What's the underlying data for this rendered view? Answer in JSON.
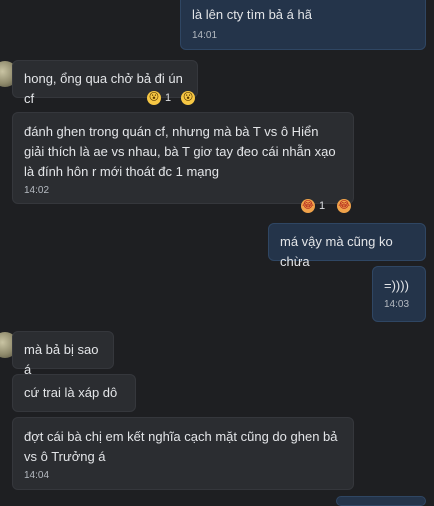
{
  "messages": [
    {
      "text": "là lên cty tìm bả á hã",
      "time": "14:01"
    },
    {
      "text": "hong, ổng qua chở bả đi ún cf",
      "reaction": {
        "emoji": "😮",
        "count": "1",
        "add_emoji": "😮"
      }
    },
    {
      "text": "đánh ghen trong quán cf, nhưng mà bà T vs ô Hiển giải thích là ae vs nhau, bà T giơ tay đeo cái nhẫn xạo là đính hôn r mới thoát đc 1 mạng",
      "time": "14:02",
      "reaction": {
        "emoji": "😂",
        "count": "1",
        "add_emoji": "😂"
      }
    },
    {
      "text": "má vậy mà cũng ko chừa"
    },
    {
      "text": "=))))",
      "time": "14:03"
    },
    {
      "text": "mà bả bị sao á"
    },
    {
      "text": "cứ trai là xáp dô"
    },
    {
      "text": "đợt cái bà chị em kết nghĩa cạch mặt cũng do ghen bả vs ô Trưởng á",
      "time": "14:04"
    }
  ]
}
